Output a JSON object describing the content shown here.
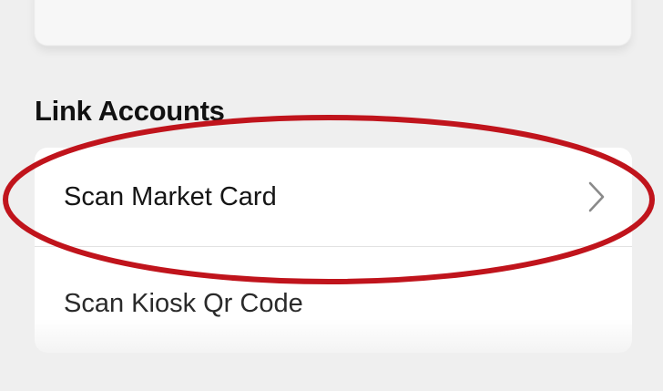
{
  "section": {
    "title": "Link Accounts"
  },
  "link_accounts": {
    "items": [
      {
        "label": "Scan Market Card",
        "icon": "chevron-right-icon"
      },
      {
        "label": "Scan Kiosk Qr Code"
      }
    ]
  },
  "colors": {
    "background": "#efefef",
    "card": "#ffffff",
    "annotation": "#c0141c",
    "chevron": "#8a8a8a"
  }
}
